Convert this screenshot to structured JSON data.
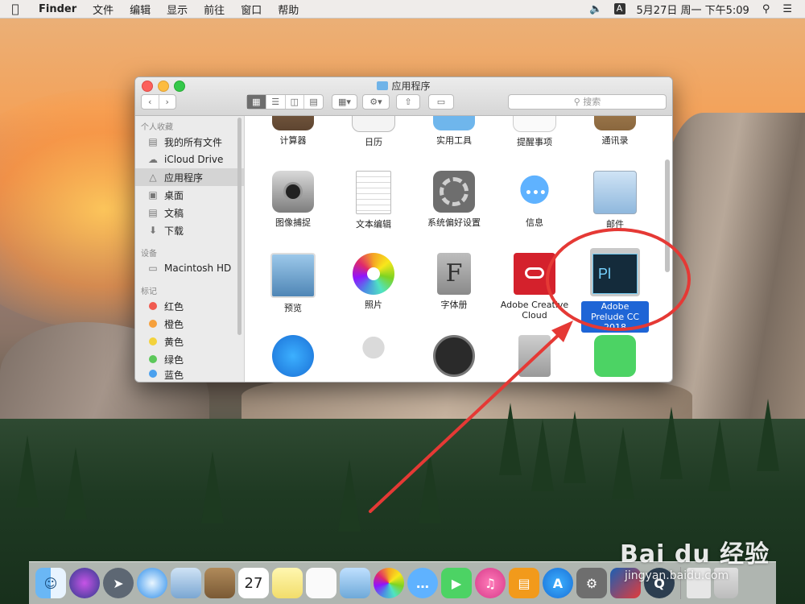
{
  "menubar": {
    "app_name": "Finder",
    "menus": [
      "文件",
      "编辑",
      "显示",
      "前往",
      "窗口",
      "帮助"
    ],
    "input_indicator": "A",
    "datetime": "5月27日 周一 下午5:09"
  },
  "window": {
    "title": "应用程序",
    "search_placeholder": "搜索"
  },
  "sidebar": {
    "favorites_heading": "个人收藏",
    "favorites": [
      {
        "label": "我的所有文件",
        "icon": "all-files-icon"
      },
      {
        "label": "iCloud Drive",
        "icon": "cloud-icon"
      },
      {
        "label": "应用程序",
        "icon": "applications-icon"
      },
      {
        "label": "桌面",
        "icon": "desktop-icon"
      },
      {
        "label": "文稿",
        "icon": "documents-icon"
      },
      {
        "label": "下载",
        "icon": "download-icon"
      }
    ],
    "devices_heading": "设备",
    "devices": [
      {
        "label": "Macintosh HD",
        "icon": "hard-disk-icon"
      }
    ],
    "tags_heading": "标记",
    "tags": [
      {
        "label": "红色",
        "color": "#f05a50"
      },
      {
        "label": "橙色",
        "color": "#f6a03c"
      },
      {
        "label": "黄色",
        "color": "#f3d23c"
      },
      {
        "label": "绿色",
        "color": "#5cc85a"
      },
      {
        "label": "蓝色",
        "color": "#4aa0ee"
      }
    ]
  },
  "apps": {
    "row1": [
      "计算器",
      "日历",
      "实用工具",
      "提醒事项",
      "通讯录"
    ],
    "row2": [
      "图像捕捉",
      "文本编辑",
      "系统偏好设置",
      "信息",
      "邮件"
    ],
    "row3": [
      "预览",
      "照片",
      "字体册",
      "Adobe Creative Cloud",
      "Adobe Prelude CC 2018"
    ],
    "prelude_icon_text": "Pl"
  },
  "dock": {
    "calendar_day": "27"
  },
  "watermark": {
    "logo": "Bai du 经验",
    "url": "jingyan.baidu.com"
  },
  "colors": {
    "selection": "#1e65d6",
    "annotation_red": "#e53935"
  }
}
